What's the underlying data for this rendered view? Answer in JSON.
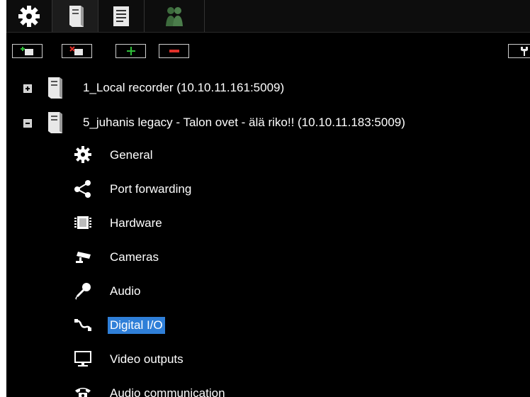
{
  "top_tabs": [
    {
      "name": "settings",
      "icon": "gear-icon"
    },
    {
      "name": "servers",
      "icon": "server-icon"
    },
    {
      "name": "document",
      "icon": "document-icon"
    },
    {
      "name": "users",
      "icon": "users-icon"
    }
  ],
  "toolbar": {
    "buttons": [
      {
        "name": "add-server",
        "icon": "add-server-icon"
      },
      {
        "name": "remove-server",
        "icon": "remove-server-icon"
      },
      {
        "name": "add",
        "icon": "plus-icon"
      },
      {
        "name": "remove",
        "icon": "minus-icon"
      }
    ],
    "right_icon": "tool-icon"
  },
  "tree": {
    "servers": [
      {
        "label": "1_Local recorder (10.10.11.161:5009)",
        "expanded": false
      },
      {
        "label": "5_juhanis legacy - Talon ovet - älä riko!! (10.10.11.183:5009)",
        "expanded": true
      }
    ],
    "children": [
      {
        "label": "General",
        "icon": "gear-icon"
      },
      {
        "label": "Port forwarding",
        "icon": "share-icon"
      },
      {
        "label": "Hardware",
        "icon": "chip-icon"
      },
      {
        "label": "Cameras",
        "icon": "camera-icon"
      },
      {
        "label": "Audio",
        "icon": "microphone-icon"
      },
      {
        "label": "Digital I/O",
        "icon": "cable-icon",
        "selected": true
      },
      {
        "label": "Video outputs",
        "icon": "monitor-icon"
      },
      {
        "label": "Audio communication",
        "icon": "phone-icon"
      }
    ]
  },
  "colors": {
    "background": "#000000",
    "selection": "#2f7fd8",
    "text": "#ffffff"
  }
}
